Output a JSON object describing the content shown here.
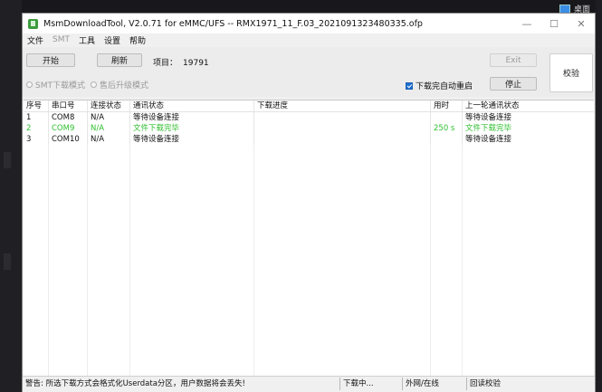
{
  "desktop": {
    "label": "桌面"
  },
  "window": {
    "title": "MsmDownloadTool, V2.0.71 for eMMC/UFS -- RMX1971_11_F.03_2021091323480335.ofp",
    "controls": {
      "minimize": "—",
      "maximize": "☐",
      "close": "✕"
    }
  },
  "menu": {
    "items": [
      {
        "label": "文件",
        "enabled": true
      },
      {
        "label": "SMT",
        "enabled": false
      },
      {
        "label": "工具",
        "enabled": true
      },
      {
        "label": "设置",
        "enabled": true
      },
      {
        "label": "帮助",
        "enabled": true
      }
    ]
  },
  "toolbar": {
    "start": "开始",
    "refresh": "刷新",
    "project_label": "项目：",
    "project_value": "19791",
    "exit": "Exit",
    "stop": "停止",
    "verify": "校验",
    "smt_mode": "SMT下载模式",
    "aftersale_mode": "售后升级模式",
    "auto_restart": "下载完自动重启"
  },
  "table": {
    "headers": [
      "序号",
      "串口号",
      "连接状态",
      "通讯状态",
      "下载进度",
      "用时",
      "上一轮通讯状态"
    ],
    "rows": [
      {
        "no": "1",
        "port": "COM8",
        "conn": "N/A",
        "comm": "等待设备连接",
        "progress": "",
        "time": "",
        "last": "等待设备连接",
        "ok": false
      },
      {
        "no": "2",
        "port": "COM9",
        "conn": "N/A",
        "comm": "文件下载完毕",
        "progress": "",
        "time": "250 s",
        "last": "文件下载完毕",
        "ok": true
      },
      {
        "no": "3",
        "port": "COM10",
        "conn": "N/A",
        "comm": "等待设备连接",
        "progress": "",
        "time": "",
        "last": "等待设备连接",
        "ok": false
      }
    ]
  },
  "status": {
    "warning": "警告: 所选下载方式会格式化Userdata分区，用户数据将会丢失!",
    "downloading": "下载中...",
    "network": "外网/在线",
    "verify": "回读校验"
  },
  "colors": {
    "success": "#2fbf2f",
    "checkbox": "#1f6fd0"
  }
}
